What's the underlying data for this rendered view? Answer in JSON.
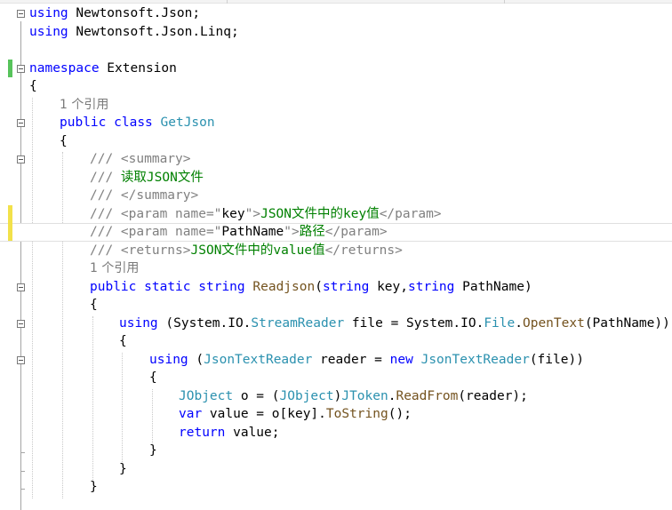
{
  "editor": {
    "lines": [
      {
        "id": 1,
        "tokens": [
          {
            "t": "using",
            "c": "kw"
          },
          {
            "t": " Newtonsoft.Json;",
            "c": ""
          }
        ]
      },
      {
        "id": 2,
        "tokens": [
          {
            "t": "using",
            "c": "kw"
          },
          {
            "t": " Newtonsoft.Json.Linq;",
            "c": ""
          }
        ]
      },
      {
        "id": 3,
        "tokens": []
      },
      {
        "id": 4,
        "tokens": [
          {
            "t": "namespace",
            "c": "kw"
          },
          {
            "t": " Extension",
            "c": ""
          }
        ]
      },
      {
        "id": 5,
        "tokens": [
          {
            "t": "{",
            "c": ""
          }
        ]
      },
      {
        "id": 6,
        "lens": "1 个引用"
      },
      {
        "id": 7,
        "tokens": [
          {
            "t": "public",
            "c": "kw"
          },
          {
            "t": " ",
            "c": ""
          },
          {
            "t": "class",
            "c": "kw"
          },
          {
            "t": " ",
            "c": ""
          },
          {
            "t": "GetJson",
            "c": "ty"
          }
        ]
      },
      {
        "id": 8,
        "tokens": [
          {
            "t": "{",
            "c": ""
          }
        ]
      },
      {
        "id": 9,
        "tokens": [
          {
            "t": "/// ",
            "c": "dc"
          },
          {
            "t": "<summary>",
            "c": "dc"
          }
        ]
      },
      {
        "id": 10,
        "tokens": [
          {
            "t": "/// ",
            "c": "dc"
          },
          {
            "t": "读取JSON文件",
            "c": "cm"
          }
        ]
      },
      {
        "id": 11,
        "tokens": [
          {
            "t": "/// ",
            "c": "dc"
          },
          {
            "t": "</summary>",
            "c": "dc"
          }
        ]
      },
      {
        "id": 12,
        "tokens": [
          {
            "t": "/// ",
            "c": "dc"
          },
          {
            "t": "<param name=\"",
            "c": "dc"
          },
          {
            "t": "key",
            "c": ""
          },
          {
            "t": "\">",
            "c": "dc"
          },
          {
            "t": "JSON文件中的key值",
            "c": "cm"
          },
          {
            "t": "</param>",
            "c": "dc"
          }
        ]
      },
      {
        "id": 13,
        "tokens": [
          {
            "t": "/// ",
            "c": "dc"
          },
          {
            "t": "<param name=\"",
            "c": "dc"
          },
          {
            "t": "PathName",
            "c": ""
          },
          {
            "t": "\">",
            "c": "dc"
          },
          {
            "t": "路径",
            "c": "cm"
          },
          {
            "t": "</param>",
            "c": "dc"
          }
        ]
      },
      {
        "id": 14,
        "tokens": [
          {
            "t": "/// ",
            "c": "dc"
          },
          {
            "t": "<returns>",
            "c": "dc"
          },
          {
            "t": "JSON文件中的value值",
            "c": "cm"
          },
          {
            "t": "</returns>",
            "c": "dc"
          }
        ]
      },
      {
        "id": 15,
        "lens": "1 个引用"
      },
      {
        "id": 16,
        "tokens": [
          {
            "t": "public",
            "c": "kw"
          },
          {
            "t": " ",
            "c": ""
          },
          {
            "t": "static",
            "c": "kw"
          },
          {
            "t": " ",
            "c": ""
          },
          {
            "t": "string",
            "c": "kw"
          },
          {
            "t": " ",
            "c": ""
          },
          {
            "t": "Readjson",
            "c": "mt"
          },
          {
            "t": "(",
            "c": ""
          },
          {
            "t": "string",
            "c": "kw"
          },
          {
            "t": " key,",
            "c": ""
          },
          {
            "t": "string",
            "c": "kw"
          },
          {
            "t": " PathName)",
            "c": ""
          }
        ]
      },
      {
        "id": 17,
        "tokens": [
          {
            "t": "{",
            "c": ""
          }
        ]
      },
      {
        "id": 18,
        "tokens": [
          {
            "t": "using",
            "c": "kw"
          },
          {
            "t": " (System.IO.",
            "c": ""
          },
          {
            "t": "StreamReader",
            "c": "ty"
          },
          {
            "t": " file = System.IO.",
            "c": ""
          },
          {
            "t": "File",
            "c": "ty"
          },
          {
            "t": ".",
            "c": ""
          },
          {
            "t": "OpenText",
            "c": "mt"
          },
          {
            "t": "(PathName))",
            "c": ""
          }
        ]
      },
      {
        "id": 19,
        "tokens": [
          {
            "t": "{",
            "c": ""
          }
        ]
      },
      {
        "id": 20,
        "tokens": [
          {
            "t": "using",
            "c": "kw"
          },
          {
            "t": " (",
            "c": ""
          },
          {
            "t": "JsonTextReader",
            "c": "ty"
          },
          {
            "t": " reader = ",
            "c": ""
          },
          {
            "t": "new",
            "c": "kw"
          },
          {
            "t": " ",
            "c": ""
          },
          {
            "t": "JsonTextReader",
            "c": "ty"
          },
          {
            "t": "(file))",
            "c": ""
          }
        ]
      },
      {
        "id": 21,
        "tokens": [
          {
            "t": "{",
            "c": ""
          }
        ]
      },
      {
        "id": 22,
        "tokens": [
          {
            "t": "JObject",
            "c": "ty"
          },
          {
            "t": " o = (",
            "c": ""
          },
          {
            "t": "JObject",
            "c": "ty"
          },
          {
            "t": ")",
            "c": ""
          },
          {
            "t": "JToken",
            "c": "ty"
          },
          {
            "t": ".",
            "c": ""
          },
          {
            "t": "ReadFrom",
            "c": "mt"
          },
          {
            "t": "(reader);",
            "c": ""
          }
        ]
      },
      {
        "id": 23,
        "tokens": [
          {
            "t": "var",
            "c": "kw"
          },
          {
            "t": " value = o[key].",
            "c": ""
          },
          {
            "t": "ToString",
            "c": "mt"
          },
          {
            "t": "();",
            "c": ""
          }
        ]
      },
      {
        "id": 24,
        "tokens": [
          {
            "t": "return",
            "c": "kw"
          },
          {
            "t": " value;",
            "c": ""
          }
        ]
      },
      {
        "id": 25,
        "tokens": [
          {
            "t": "}",
            "c": ""
          }
        ]
      },
      {
        "id": 26,
        "tokens": [
          {
            "t": "}",
            "c": ""
          }
        ]
      },
      {
        "id": 27,
        "tokens": [
          {
            "t": "}",
            "c": ""
          }
        ]
      }
    ]
  }
}
